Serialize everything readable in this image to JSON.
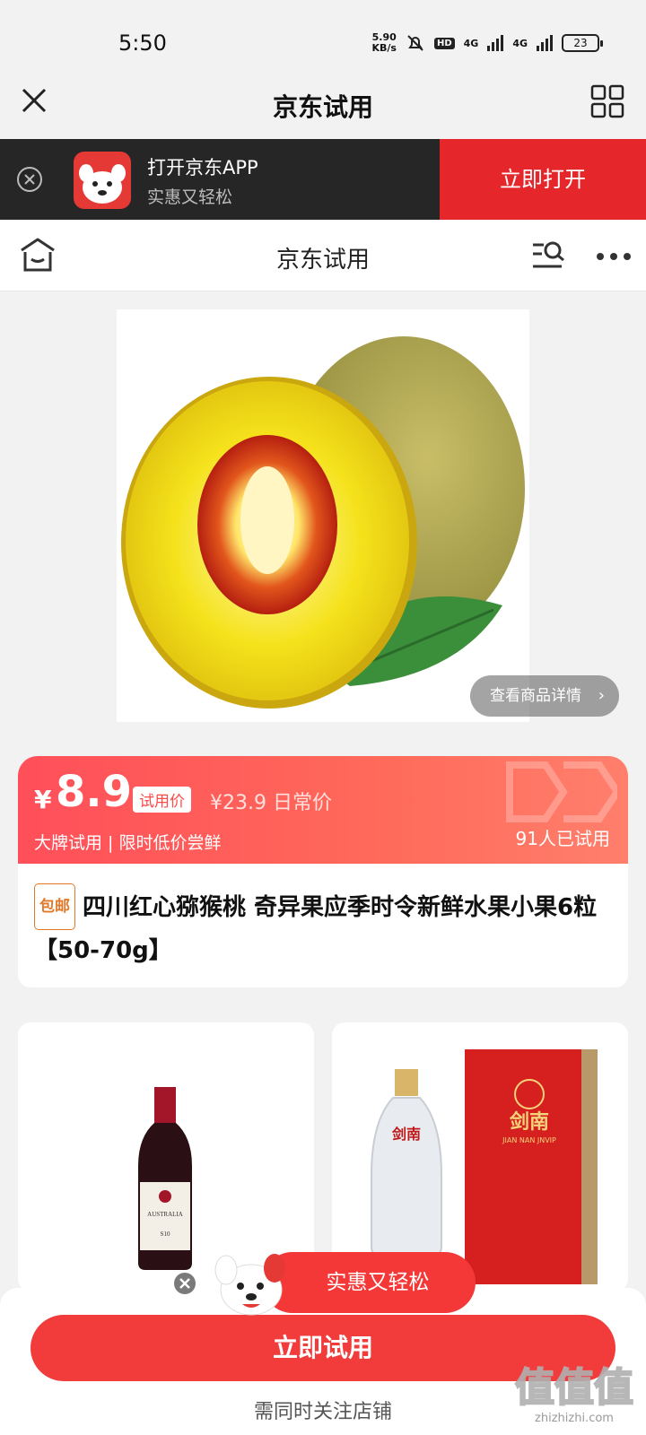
{
  "status_bar": {
    "time": "5:50",
    "speed_value": "5.90",
    "speed_unit": "KB/s",
    "hd_label": "HD",
    "net1": "4G",
    "net2": "4G",
    "battery": "23"
  },
  "top_nav": {
    "title": "京东试用"
  },
  "app_banner": {
    "title": "打开京东APP",
    "subtitle": "实惠又轻松",
    "open_label": "立即打开"
  },
  "page_header": {
    "title": "京东试用"
  },
  "product": {
    "detail_link_label": "查看商品详情",
    "currency": "¥",
    "trial_price": "8.9",
    "trial_tag": "试用价",
    "regular_price": "¥23.9",
    "regular_label": "日常价",
    "slogan": "大牌试用 | 限时低价尝鲜",
    "tried_count": "91人已试用",
    "shipping_tag": "包邮",
    "name": "四川红心猕猴桃 奇异果应季时令新鲜水果小果6粒【50-70g】"
  },
  "recommendations": [
    {
      "label_lines": [
        "AUSTRALIA",
        "S10"
      ]
    },
    {
      "label_lines": [
        "剑南",
        "JIAN NAN JNVIP"
      ]
    }
  ],
  "promo": {
    "label": "实惠又轻松"
  },
  "bottom_bar": {
    "try_button": "立即试用",
    "follow_note": "需同时关注店铺"
  },
  "watermark": {
    "text": "值值值",
    "domain": "zhizhizhi.com"
  },
  "colors": {
    "brand_red": "#e5262b",
    "price_gradient_start": "#ff4f5a",
    "try_button": "#f23b3b",
    "shipping_tag": "#e07a2a"
  }
}
